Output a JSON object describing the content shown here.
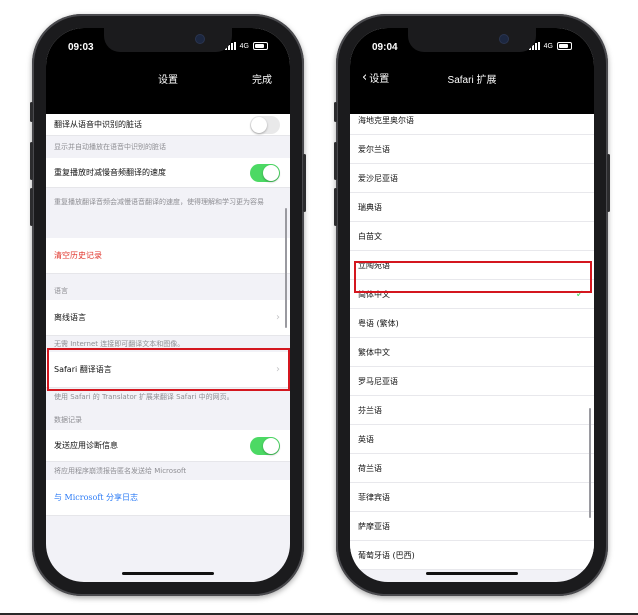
{
  "left_phone": {
    "status": {
      "time": "09:03",
      "network": "4G"
    },
    "nav": {
      "title": "设置",
      "done": "完成"
    },
    "rows": {
      "translate_from_speech": "翻译从语音中识别的脏话",
      "auto_play_note": "显示并自动播放在语音中识别的脏话",
      "slow_playback": "重复播放时减慢音频翻译的速度",
      "slow_playback_note": "重复播放翻译音频会减慢语音翻译的速度，使得理解和学习更为容易",
      "clear_history": "清空历史记录",
      "language_header": "语言",
      "offline_languages": "离线语言",
      "offline_note": "无需 Internet 连接即可翻译文本和图像。",
      "safari_language": "Safari 翻译语言",
      "safari_note": "使用 Safari 的 Translator 扩展来翻译 Safari 中的网页。",
      "data_header": "数据记录",
      "send_diagnostics": "发送应用诊断信息",
      "diagnostics_note": "将应用程序崩溃报告匿名发送给 Microsoft",
      "share_logs": "与 Microsoft 分享日志"
    }
  },
  "right_phone": {
    "status": {
      "time": "09:04",
      "network": "4G"
    },
    "nav": {
      "back": "设置",
      "title": "Safari 扩展"
    },
    "languages": [
      "海地克里奥尔语",
      "爱尔兰语",
      "爱沙尼亚语",
      "瑞典语",
      "白苗文",
      "立陶宛语",
      "简体中文",
      "粤语 (繁体)",
      "繁体中文",
      "罗马尼亚语",
      "芬兰语",
      "英语",
      "荷兰语",
      "菲律宾语",
      "萨摩亚语",
      "葡萄牙语 (巴西)"
    ],
    "selected_language": "简体中文",
    "selected_mark": "✓"
  },
  "colors": {
    "accent_green": "#4cd964",
    "destructive_red": "#e0342b",
    "link_blue": "#2d7cf6",
    "highlight_red": "#d4171f"
  }
}
